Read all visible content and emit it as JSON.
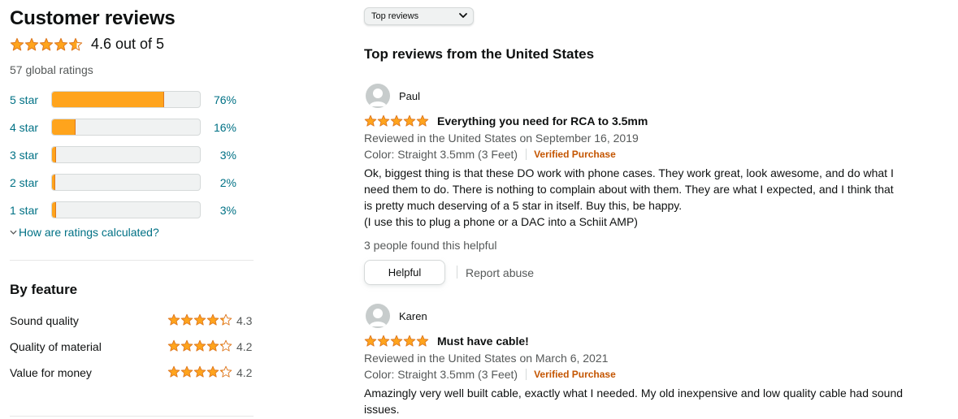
{
  "summary": {
    "title": "Customer reviews",
    "rating_text": "4.6 out of 5",
    "average": 4.6,
    "global_ratings": "57 global ratings",
    "histogram": [
      {
        "label": "5 star",
        "pct_text": "76%",
        "pct": 76
      },
      {
        "label": "4 star",
        "pct_text": "16%",
        "pct": 16
      },
      {
        "label": "3 star",
        "pct_text": "3%",
        "pct": 3
      },
      {
        "label": "2 star",
        "pct_text": "2%",
        "pct": 2
      },
      {
        "label": "1 star",
        "pct_text": "3%",
        "pct": 3
      }
    ],
    "how_link": "How are ratings calculated?"
  },
  "features": {
    "title": "By feature",
    "items": [
      {
        "name": "Sound quality",
        "rating": 4.3,
        "value_text": "4.3"
      },
      {
        "name": "Quality of material",
        "rating": 4.2,
        "value_text": "4.2"
      },
      {
        "name": "Value for money",
        "rating": 4.2,
        "value_text": "4.2"
      }
    ]
  },
  "sort": {
    "selected": "Top reviews"
  },
  "reviews_section": {
    "title": "Top reviews from the United States"
  },
  "reviews": [
    {
      "name": "Paul",
      "rating": 5,
      "title": "Everything you need for RCA to 3.5mm",
      "date": "Reviewed in the United States on September 16, 2019",
      "variant": "Color: Straight 3.5mm (3 Feet)",
      "verified": "Verified Purchase",
      "body": [
        "Ok, biggest thing is that these DO work with phone cases. They work great, look awesome, and do what I",
        "need them to do. There is nothing to complain about with them. They are what I expected, and I think that",
        "is pretty much deserving of a 5 star in itself. Buy this, be happy.",
        "(I use this to plug a phone or a DAC into a Schiit AMP)"
      ],
      "helpful_count": "3 people found this helpful",
      "helpful_button": "Helpful",
      "report": "Report abuse"
    },
    {
      "name": "Karen",
      "rating": 5,
      "title": "Must have cable!",
      "date": "Reviewed in the United States on March 6, 2021",
      "variant": "Color: Straight 3.5mm (3 Feet)",
      "verified": "Verified Purchase",
      "body": [
        "Amazingly very well built cable, exactly what I needed. My old inexpensive and low quality cable had sound",
        "issues."
      ]
    }
  ],
  "colors": {
    "star_fill": "#ffa41c",
    "star_stroke": "#de7921",
    "link": "#007185",
    "verified": "#c45500"
  },
  "icons": {
    "star": "star-icon",
    "avatar": "user-avatar-icon",
    "chevron_down": "chevron-down-icon"
  }
}
